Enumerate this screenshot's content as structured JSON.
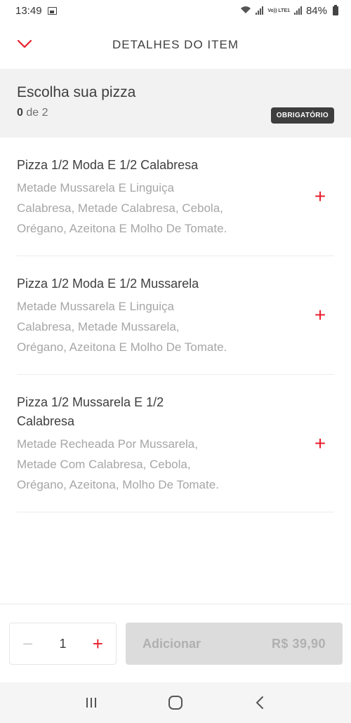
{
  "status_bar": {
    "time": "13:49",
    "volte_label": "Vo)) LTE1",
    "battery": "84%"
  },
  "header": {
    "title": "DETALHES DO ITEM",
    "back_icon": "chevron-down-icon",
    "accent_color": "#ea1d2c"
  },
  "section": {
    "title": "Escolha sua pizza",
    "count_selected": "0",
    "count_rest": " de 2",
    "badge": "OBRIGATÓRIO"
  },
  "options": [
    {
      "name": "Pizza 1/2 Moda E 1/2 Calabresa",
      "description": "Metade Mussarela E Linguiça Calabresa, Metade Calabresa, Cebola, Orégano, Azeitona E Molho De  Tomate.",
      "add_icon": "plus-icon"
    },
    {
      "name": "Pizza 1/2 Moda E 1/2 Mussarela",
      "description": "Metade Mussarela E Linguiça Calabresa, Metade Mussarela, Orégano, Azeitona E Molho De Tomate.",
      "add_icon": "plus-icon"
    },
    {
      "name": "Pizza 1/2 Mussarela E 1/2 Calabresa",
      "description": "Metade Recheada Por Mussarela, Metade Com Calabresa, Cebola, Orégano, Azeitona, Molho De  Tomate.",
      "add_icon": "plus-icon"
    }
  ],
  "bottom_bar": {
    "quantity": "1",
    "minus_label": "−",
    "plus_label": "+",
    "add_label": "Adicionar",
    "price": "R$ 39,90"
  },
  "nav_bar": {
    "recents_icon": "recents-icon",
    "home_icon": "home-icon",
    "back_icon": "back-icon"
  }
}
